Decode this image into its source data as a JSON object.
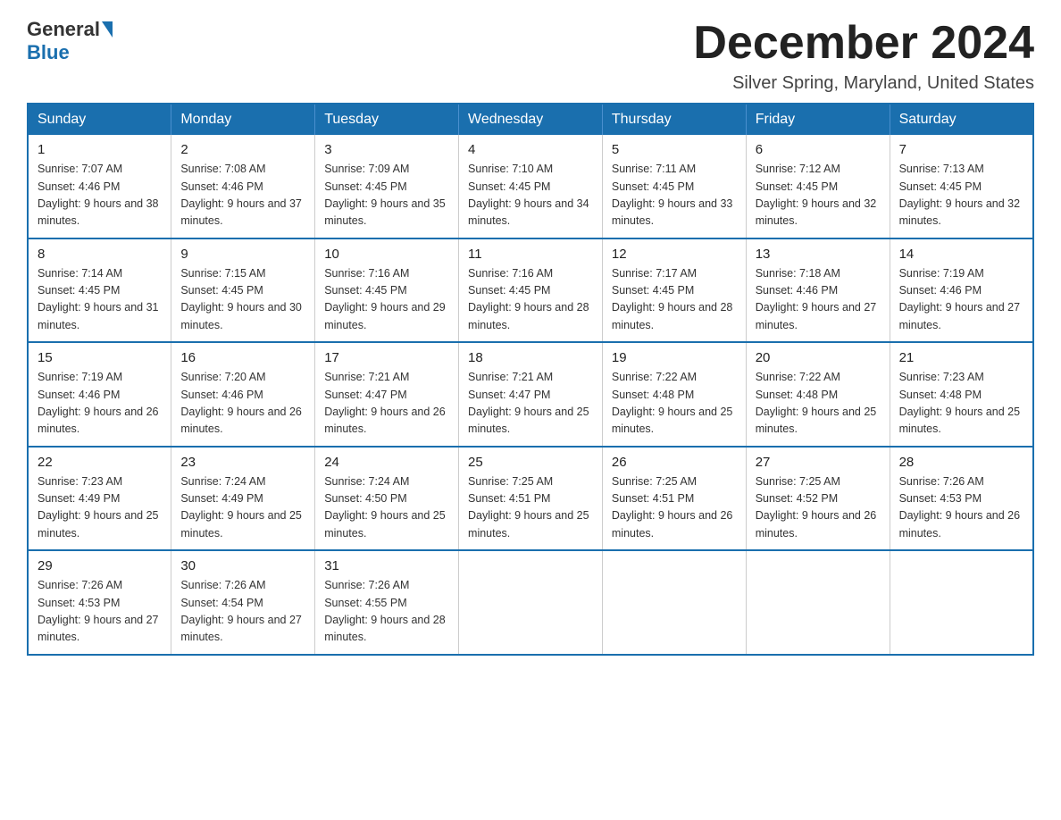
{
  "header": {
    "logo_general": "General",
    "logo_blue": "Blue",
    "month_title": "December 2024",
    "location": "Silver Spring, Maryland, United States"
  },
  "weekdays": [
    "Sunday",
    "Monday",
    "Tuesday",
    "Wednesday",
    "Thursday",
    "Friday",
    "Saturday"
  ],
  "weeks": [
    [
      {
        "day": "1",
        "sunrise": "7:07 AM",
        "sunset": "4:46 PM",
        "daylight": "9 hours and 38 minutes."
      },
      {
        "day": "2",
        "sunrise": "7:08 AM",
        "sunset": "4:46 PM",
        "daylight": "9 hours and 37 minutes."
      },
      {
        "day": "3",
        "sunrise": "7:09 AM",
        "sunset": "4:45 PM",
        "daylight": "9 hours and 35 minutes."
      },
      {
        "day": "4",
        "sunrise": "7:10 AM",
        "sunset": "4:45 PM",
        "daylight": "9 hours and 34 minutes."
      },
      {
        "day": "5",
        "sunrise": "7:11 AM",
        "sunset": "4:45 PM",
        "daylight": "9 hours and 33 minutes."
      },
      {
        "day": "6",
        "sunrise": "7:12 AM",
        "sunset": "4:45 PM",
        "daylight": "9 hours and 32 minutes."
      },
      {
        "day": "7",
        "sunrise": "7:13 AM",
        "sunset": "4:45 PM",
        "daylight": "9 hours and 32 minutes."
      }
    ],
    [
      {
        "day": "8",
        "sunrise": "7:14 AM",
        "sunset": "4:45 PM",
        "daylight": "9 hours and 31 minutes."
      },
      {
        "day": "9",
        "sunrise": "7:15 AM",
        "sunset": "4:45 PM",
        "daylight": "9 hours and 30 minutes."
      },
      {
        "day": "10",
        "sunrise": "7:16 AM",
        "sunset": "4:45 PM",
        "daylight": "9 hours and 29 minutes."
      },
      {
        "day": "11",
        "sunrise": "7:16 AM",
        "sunset": "4:45 PM",
        "daylight": "9 hours and 28 minutes."
      },
      {
        "day": "12",
        "sunrise": "7:17 AM",
        "sunset": "4:45 PM",
        "daylight": "9 hours and 28 minutes."
      },
      {
        "day": "13",
        "sunrise": "7:18 AM",
        "sunset": "4:46 PM",
        "daylight": "9 hours and 27 minutes."
      },
      {
        "day": "14",
        "sunrise": "7:19 AM",
        "sunset": "4:46 PM",
        "daylight": "9 hours and 27 minutes."
      }
    ],
    [
      {
        "day": "15",
        "sunrise": "7:19 AM",
        "sunset": "4:46 PM",
        "daylight": "9 hours and 26 minutes."
      },
      {
        "day": "16",
        "sunrise": "7:20 AM",
        "sunset": "4:46 PM",
        "daylight": "9 hours and 26 minutes."
      },
      {
        "day": "17",
        "sunrise": "7:21 AM",
        "sunset": "4:47 PM",
        "daylight": "9 hours and 26 minutes."
      },
      {
        "day": "18",
        "sunrise": "7:21 AM",
        "sunset": "4:47 PM",
        "daylight": "9 hours and 25 minutes."
      },
      {
        "day": "19",
        "sunrise": "7:22 AM",
        "sunset": "4:48 PM",
        "daylight": "9 hours and 25 minutes."
      },
      {
        "day": "20",
        "sunrise": "7:22 AM",
        "sunset": "4:48 PM",
        "daylight": "9 hours and 25 minutes."
      },
      {
        "day": "21",
        "sunrise": "7:23 AM",
        "sunset": "4:48 PM",
        "daylight": "9 hours and 25 minutes."
      }
    ],
    [
      {
        "day": "22",
        "sunrise": "7:23 AM",
        "sunset": "4:49 PM",
        "daylight": "9 hours and 25 minutes."
      },
      {
        "day": "23",
        "sunrise": "7:24 AM",
        "sunset": "4:49 PM",
        "daylight": "9 hours and 25 minutes."
      },
      {
        "day": "24",
        "sunrise": "7:24 AM",
        "sunset": "4:50 PM",
        "daylight": "9 hours and 25 minutes."
      },
      {
        "day": "25",
        "sunrise": "7:25 AM",
        "sunset": "4:51 PM",
        "daylight": "9 hours and 25 minutes."
      },
      {
        "day": "26",
        "sunrise": "7:25 AM",
        "sunset": "4:51 PM",
        "daylight": "9 hours and 26 minutes."
      },
      {
        "day": "27",
        "sunrise": "7:25 AM",
        "sunset": "4:52 PM",
        "daylight": "9 hours and 26 minutes."
      },
      {
        "day": "28",
        "sunrise": "7:26 AM",
        "sunset": "4:53 PM",
        "daylight": "9 hours and 26 minutes."
      }
    ],
    [
      {
        "day": "29",
        "sunrise": "7:26 AM",
        "sunset": "4:53 PM",
        "daylight": "9 hours and 27 minutes."
      },
      {
        "day": "30",
        "sunrise": "7:26 AM",
        "sunset": "4:54 PM",
        "daylight": "9 hours and 27 minutes."
      },
      {
        "day": "31",
        "sunrise": "7:26 AM",
        "sunset": "4:55 PM",
        "daylight": "9 hours and 28 minutes."
      },
      null,
      null,
      null,
      null
    ]
  ]
}
